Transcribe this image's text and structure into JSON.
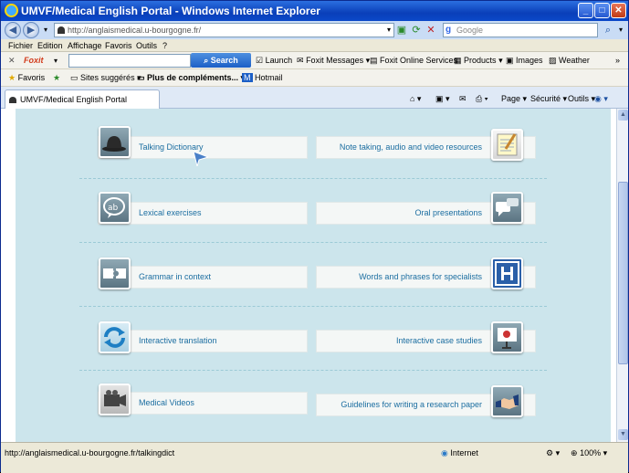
{
  "window": {
    "title": "UMVF/Medical English Portal - Windows Internet Explorer"
  },
  "address_bar": {
    "url": "http://anglaismedical.u-bourgogne.fr/",
    "search_placeholder": "Google"
  },
  "menu": [
    "Fichier",
    "Edition",
    "Affichage",
    "Favoris",
    "Outils",
    "?"
  ],
  "foxit_toolbar": {
    "brand": "Foxit",
    "search_label": "Search",
    "items": [
      "Launch",
      "Foxit Messages",
      "Foxit Online Services",
      "Products",
      "Images",
      "Weather"
    ]
  },
  "favorites_bar": {
    "favorites_label": "Favoris",
    "items": [
      "Sites suggérés",
      "Plus de compléments...",
      "Hotmail"
    ]
  },
  "tab": {
    "label": "UMVF/Medical English Portal"
  },
  "command_bar": {
    "page": "Page",
    "security": "Sécurité",
    "tools": "Outils"
  },
  "portal": {
    "left": [
      "Talking Dictionary",
      "Lexical exercises",
      "Grammar in context",
      "Interactive translation",
      "Medical Videos"
    ],
    "right": [
      "Note taking, audio and video resources",
      "Oral presentations",
      "Words and phrases for specialists",
      "Interactive case studies",
      "Guidelines for writing a research paper"
    ],
    "left_icons": [
      "bowler-hat-icon",
      "ab-speech-bubble-icon",
      "puzzle-pieces-icon",
      "refresh-arrows-icon",
      "video-camera-icon"
    ],
    "right_icons": [
      "notepad-icon",
      "speech-bubbles-icon",
      "hospital-h-icon",
      "presentation-board-icon",
      "handshake-icon"
    ]
  },
  "status_bar": {
    "link": "http://anglaismedical.u-bourgogne.fr/talkingdict",
    "zone": "Internet",
    "zoom": "100%"
  }
}
